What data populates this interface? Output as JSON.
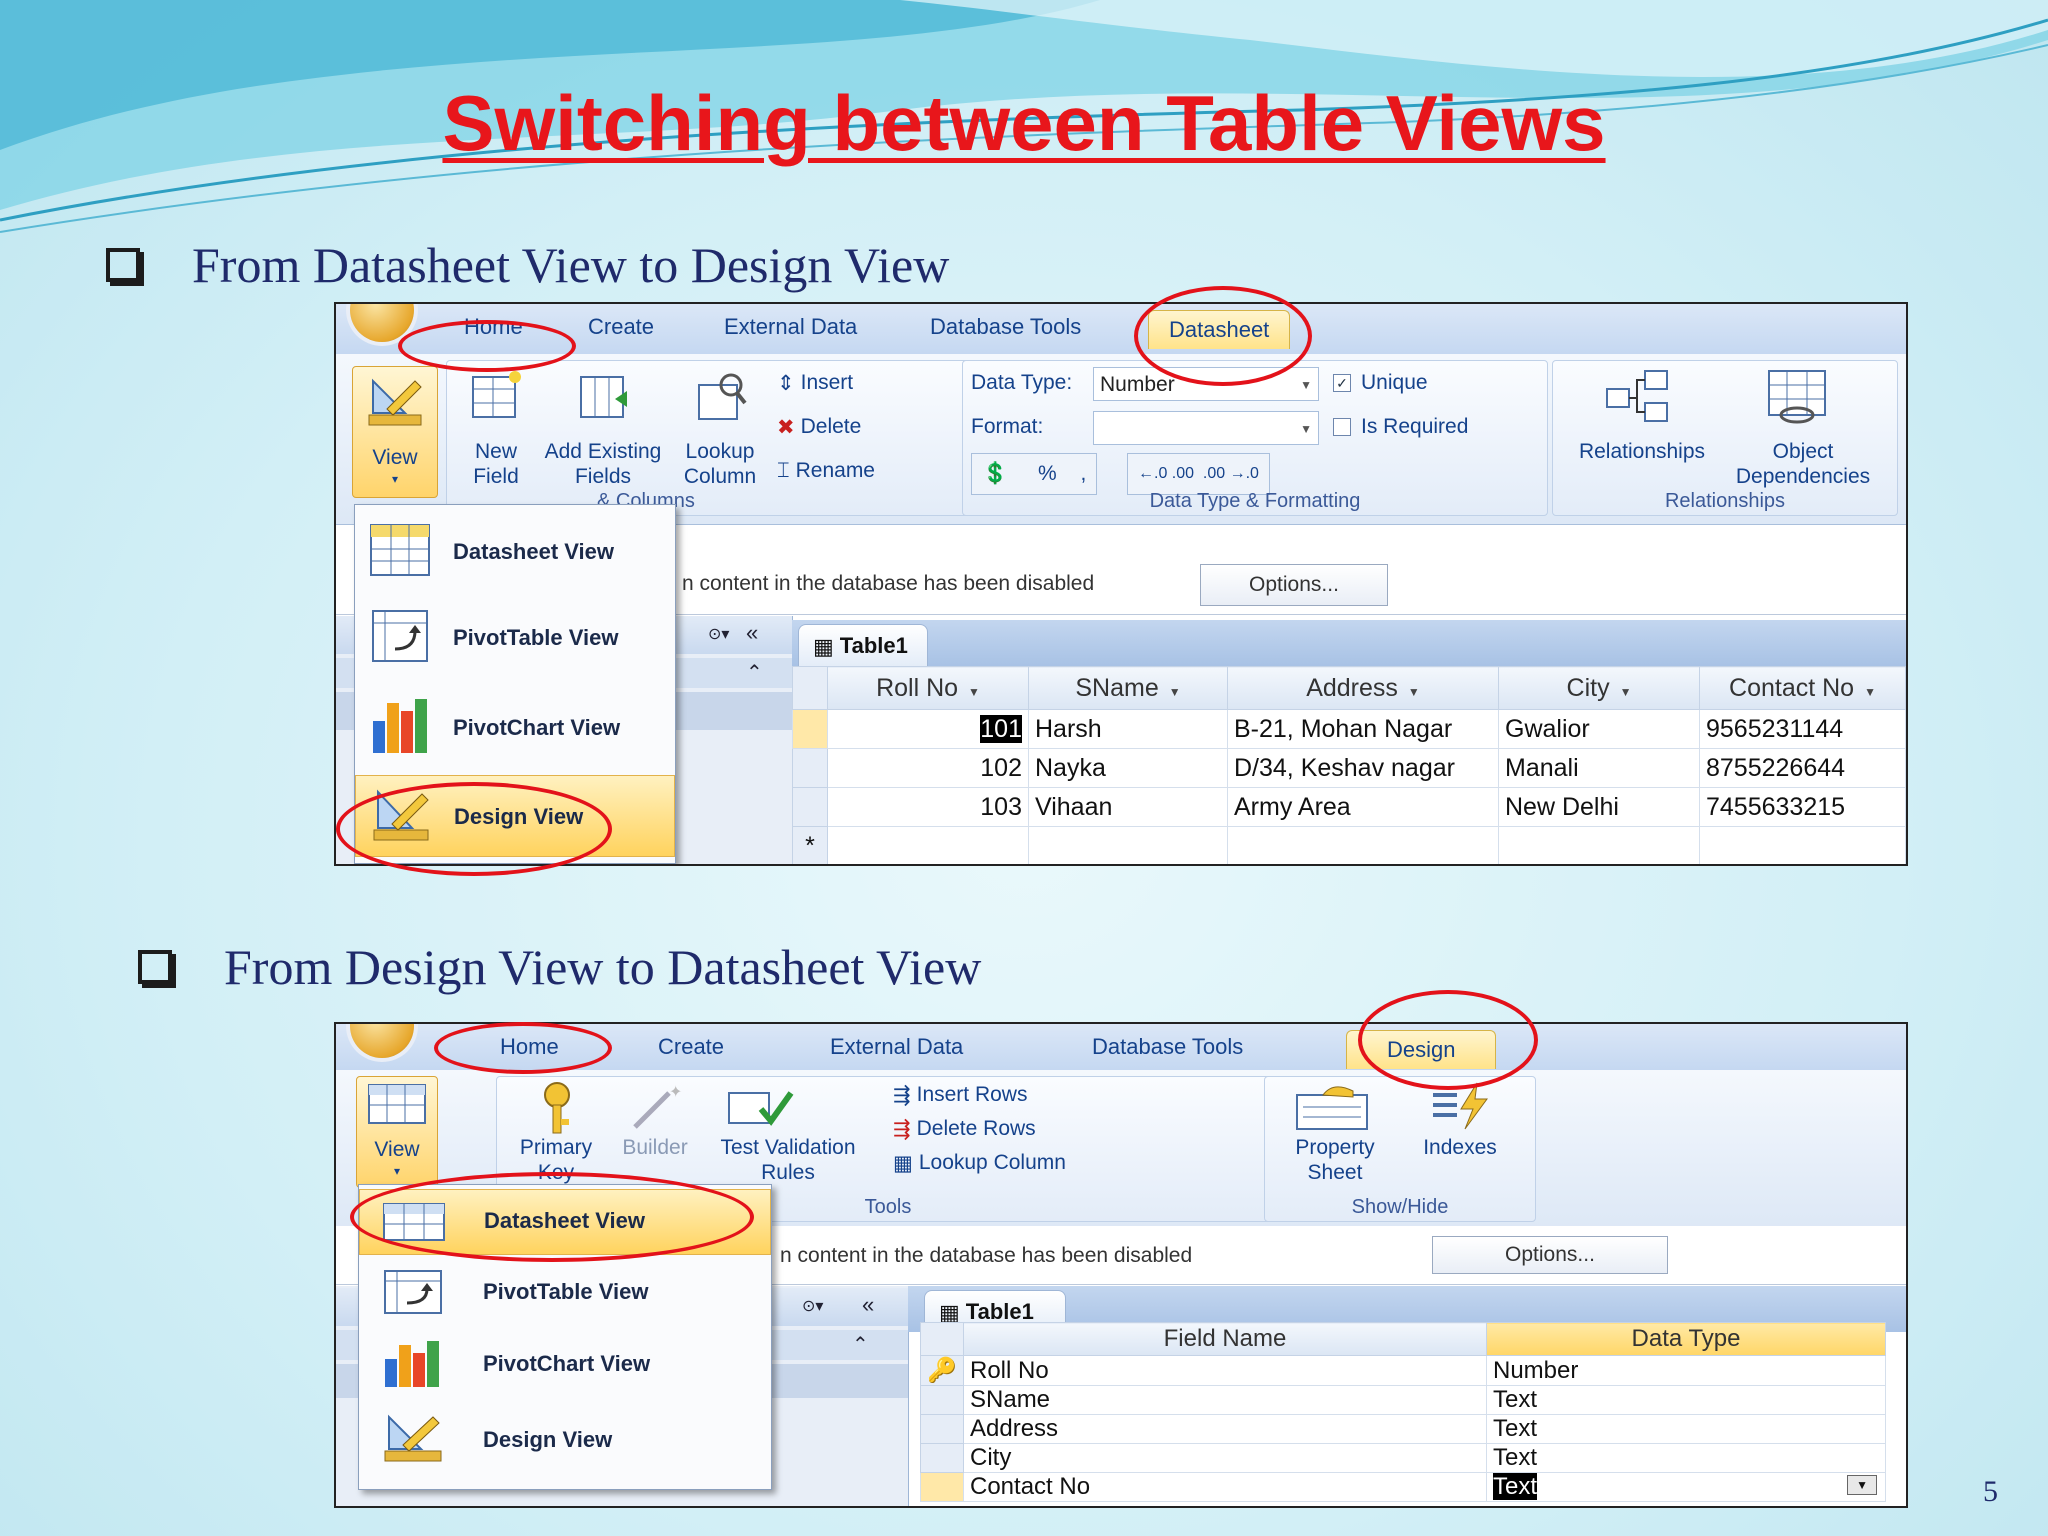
{
  "slide": {
    "title": "Switching between Table Views",
    "page_number": "5",
    "bullet1": "From Datasheet View to Design View",
    "bullet2": "From Design View to Datasheet View"
  },
  "shot1": {
    "tabs": [
      "Home",
      "Create",
      "External Data",
      "Database Tools",
      "Datasheet"
    ],
    "view_label": "View",
    "new_field": [
      "New",
      "Field"
    ],
    "add_existing": [
      "Add Existing",
      "Fields"
    ],
    "lookup": [
      "Lookup",
      "Column"
    ],
    "insert": "Insert",
    "delete": "Delete",
    "rename": "Rename",
    "fields_group": "& Columns",
    "data_type_label": "Data Type:",
    "data_type_value": "Number",
    "format_label": "Format:",
    "unique": "Unique",
    "is_required": "Is Required",
    "percent": "%",
    "comma": ",",
    "dt_group": "Data Type & Formatting",
    "relationships": "Relationships",
    "object_dep": [
      "Object",
      "Dependencies"
    ],
    "rel_group": "Relationships",
    "message": "n content in the database has been disabled",
    "options": "Options...",
    "table_tab": "Table1",
    "columns": [
      "Roll No",
      "SName",
      "Address",
      "City",
      "Contact No"
    ],
    "rows": [
      [
        "101",
        "Harsh",
        "B-21, Mohan Nagar",
        "Gwalior",
        "9565231144"
      ],
      [
        "102",
        "Nayka",
        "D/34, Keshav nagar",
        "Manali",
        "8755226644"
      ],
      [
        "103",
        "Vihaan",
        "Army Area",
        "New Delhi",
        "7455633215"
      ]
    ],
    "new_row_marker": "*",
    "menu": [
      "Datasheet View",
      "PivotTable View",
      "PivotChart View",
      "Design View"
    ]
  },
  "shot2": {
    "tabs": [
      "Home",
      "Create",
      "External Data",
      "Database Tools",
      "Design"
    ],
    "view_label": "View",
    "primary_key": [
      "Primary",
      "Key"
    ],
    "builder": "Builder",
    "test_validation": [
      "Test Validation",
      "Rules"
    ],
    "insert_rows": "Insert Rows",
    "delete_rows": "Delete Rows",
    "lookup_column": "Lookup Column",
    "tools_group": "Tools",
    "property_sheet": [
      "Property",
      "Sheet"
    ],
    "indexes": "Indexes",
    "showhide_group": "Show/Hide",
    "message": "n content in the database has been disabled",
    "options": "Options...",
    "table_tab": "Table1",
    "columns": [
      "Field Name",
      "Data Type"
    ],
    "rows": [
      [
        "Roll No",
        "Number"
      ],
      [
        "SName",
        "Text"
      ],
      [
        "Address",
        "Text"
      ],
      [
        "City",
        "Text"
      ],
      [
        "Contact No",
        "Text"
      ]
    ],
    "menu": [
      "Datasheet View",
      "PivotTable View",
      "PivotChart View",
      "Design View"
    ]
  },
  "colors": {
    "title": "#e8161b",
    "bullet_text": "#1f2a6b",
    "annotation_ring": "#e3121a"
  }
}
